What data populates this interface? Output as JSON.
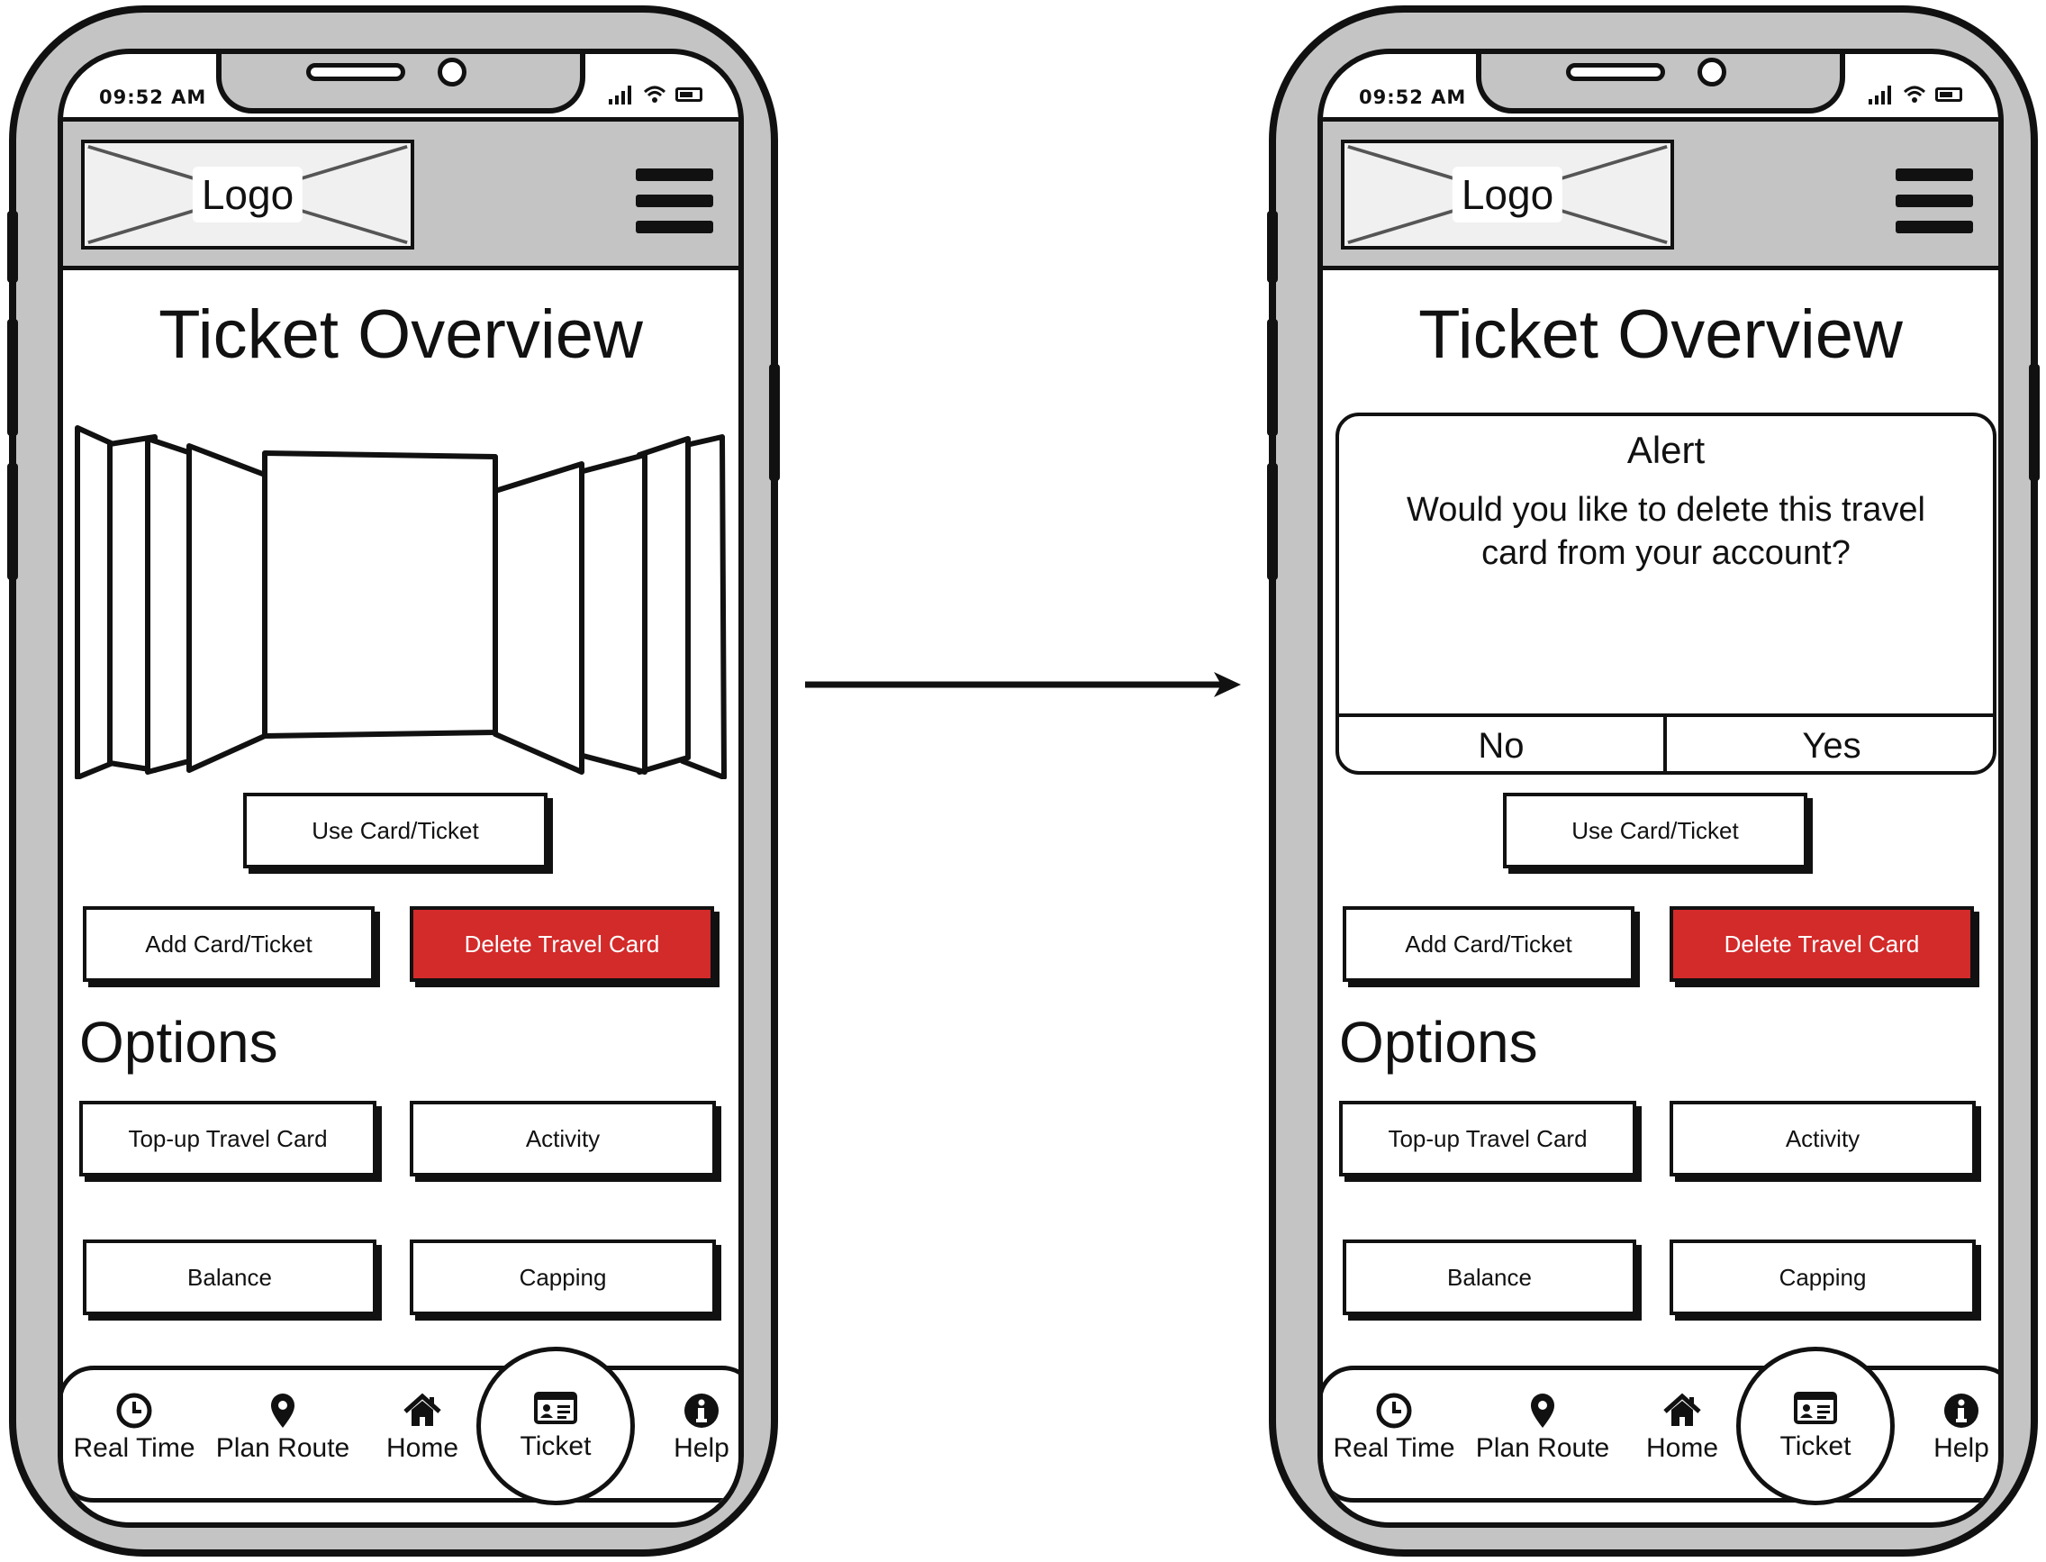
{
  "flow_arrow": "right-arrow",
  "screens": [
    {
      "status": {
        "time": "09:52 AM"
      },
      "header": {
        "logo": "Logo",
        "menu_icon": "hamburger-menu-icon"
      },
      "title": "Ticket Overview",
      "buttons": {
        "use": "Use Card/Ticket",
        "add": "Add Card/Ticket",
        "delete": "Delete Travel Card"
      },
      "options": {
        "heading": "Options",
        "items": [
          "Top-up Travel Card",
          "Activity",
          "Balance",
          "Capping"
        ]
      },
      "nav": {
        "items": [
          {
            "label": "Real Time",
            "icon": "clock-icon"
          },
          {
            "label": "Plan Route",
            "icon": "map-pin-icon"
          },
          {
            "label": "Home",
            "icon": "home-icon"
          },
          {
            "label": "Ticket",
            "icon": "id-card-icon"
          },
          {
            "label": "Help",
            "icon": "info-icon"
          }
        ]
      }
    },
    {
      "status": {
        "time": "09:52 AM"
      },
      "header": {
        "logo": "Logo",
        "menu_icon": "hamburger-menu-icon"
      },
      "title": "Ticket Overview",
      "alert": {
        "title": "Alert",
        "message": "Would you like to delete this travel card from your account?",
        "no": "No",
        "yes": "Yes"
      },
      "buttons": {
        "use": "Use Card/Ticket",
        "add": "Add Card/Ticket",
        "delete": "Delete Travel Card"
      },
      "options": {
        "heading": "Options",
        "items": [
          "Top-up Travel Card",
          "Activity",
          "Balance",
          "Capping"
        ]
      },
      "nav": {
        "items": [
          {
            "label": "Real Time",
            "icon": "clock-icon"
          },
          {
            "label": "Plan Route",
            "icon": "map-pin-icon"
          },
          {
            "label": "Home",
            "icon": "home-icon"
          },
          {
            "label": "Ticket",
            "icon": "id-card-icon"
          },
          {
            "label": "Help",
            "icon": "info-icon"
          }
        ]
      }
    }
  ],
  "colors": {
    "frame": "#c4c4c4",
    "accent_red": "#d32a2a",
    "ink": "#111111"
  }
}
